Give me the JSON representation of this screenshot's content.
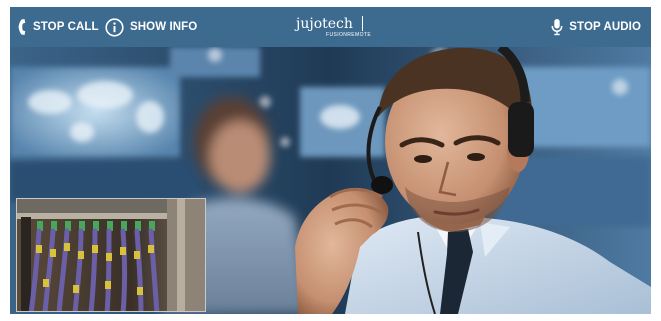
{
  "toolbar": {
    "stop_call_label": "STOP CALL",
    "show_info_label": "SHOW INFO",
    "stop_audio_label": "STOP AUDIO",
    "stop_call_icon": "phone-icon",
    "show_info_icon": "info-icon",
    "stop_audio_icon": "microphone-icon"
  },
  "logo": {
    "name": "jujotech",
    "subtitle": "FUSIONREMOTE"
  },
  "colors": {
    "toolbar_bg": "#3d6b90",
    "toolbar_text": "#ffffff",
    "scene_bg": "#1a2f42"
  }
}
